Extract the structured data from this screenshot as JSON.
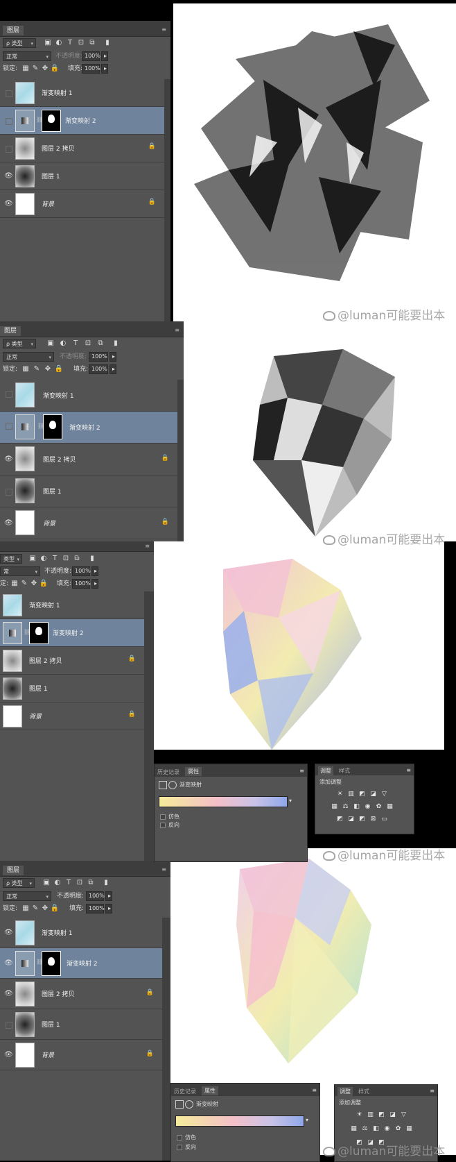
{
  "panels": [
    {
      "tab": "图层",
      "kind_filter": "类型",
      "blend_mode": "正常",
      "opacity_label": "不透明度:",
      "opacity_value": "100%",
      "lock_label": "锁定:",
      "fill_label": "填充:",
      "fill_value": "100%",
      "layers": [
        {
          "name": "渐变映射 1",
          "visible": false,
          "locked": false,
          "selected": false
        },
        {
          "name": "渐变映射 2",
          "visible": false,
          "locked": false,
          "selected": true
        },
        {
          "name": "图层 2 拷贝",
          "visible": false,
          "locked": true,
          "selected": false
        },
        {
          "name": "图层 1",
          "visible": true,
          "locked": false,
          "selected": false
        },
        {
          "name": "背景",
          "visible": true,
          "locked": true,
          "selected": false
        }
      ]
    },
    {
      "tab": "图层",
      "kind_filter": "类型",
      "blend_mode": "正常",
      "opacity_label": "不透明度:",
      "opacity_value": "100%",
      "lock_label": "锁定:",
      "fill_label": "填充:",
      "fill_value": "100%",
      "layers": [
        {
          "name": "渐变映射 1",
          "visible": false,
          "locked": false,
          "selected": false
        },
        {
          "name": "渐变映射 2",
          "visible": false,
          "locked": false,
          "selected": true
        },
        {
          "name": "图层 2 拷贝",
          "visible": true,
          "locked": true,
          "selected": false
        },
        {
          "name": "图层 1",
          "visible": false,
          "locked": false,
          "selected": false
        },
        {
          "name": "背景",
          "visible": true,
          "locked": true,
          "selected": false
        }
      ]
    },
    {
      "tab": "图层",
      "kind_filter": "类型",
      "blend_mode": "常",
      "opacity_label": "不透明度:",
      "opacity_value": "100%",
      "lock_label": "定:",
      "fill_label": "填充:",
      "fill_value": "100%",
      "layers": [
        {
          "name": "渐变映射 1",
          "visible": true,
          "locked": false,
          "selected": false
        },
        {
          "name": "渐变映射 2",
          "visible": true,
          "locked": false,
          "selected": true
        },
        {
          "name": "图层 2 拷贝",
          "visible": true,
          "locked": true,
          "selected": false
        },
        {
          "name": "图层 1",
          "visible": false,
          "locked": false,
          "selected": false
        },
        {
          "name": "背景",
          "visible": true,
          "locked": true,
          "selected": false
        }
      ]
    },
    {
      "tab": "图层",
      "kind_filter": "类型",
      "blend_mode": "正常",
      "opacity_label": "不透明度:",
      "opacity_value": "100%",
      "lock_label": "锁定:",
      "fill_label": "填充:",
      "fill_value": "100%",
      "layers": [
        {
          "name": "渐变映射 1",
          "visible": true,
          "locked": false,
          "selected": false
        },
        {
          "name": "渐变映射 2",
          "visible": true,
          "locked": false,
          "selected": true
        },
        {
          "name": "图层 2 拷贝",
          "visible": true,
          "locked": true,
          "selected": false
        },
        {
          "name": "图层 1",
          "visible": false,
          "locked": false,
          "selected": false
        },
        {
          "name": "背景",
          "visible": true,
          "locked": true,
          "selected": false
        }
      ]
    }
  ],
  "properties": {
    "tab_history": "历史记录",
    "tab_properties": "属性",
    "title": "渐变映射",
    "dither_label": "仿色",
    "reverse_label": "反向",
    "gradient_colors": [
      "#f5ec9a",
      "#f4c0c8",
      "#c9c3e8",
      "#8fa8ea"
    ]
  },
  "adjustments": {
    "tab_adjust": "调整",
    "tab_styles": "样式",
    "title": "添加调整"
  },
  "watermark": "@luman可能要出本",
  "colors": {
    "panel_bg": "#535353",
    "selected_row": "#6f839c",
    "canvas": "#ffffff",
    "crystal_pink": "#f3c2d6",
    "crystal_blue": "#9fb3ea",
    "crystal_yellow": "#f2ecb0"
  }
}
